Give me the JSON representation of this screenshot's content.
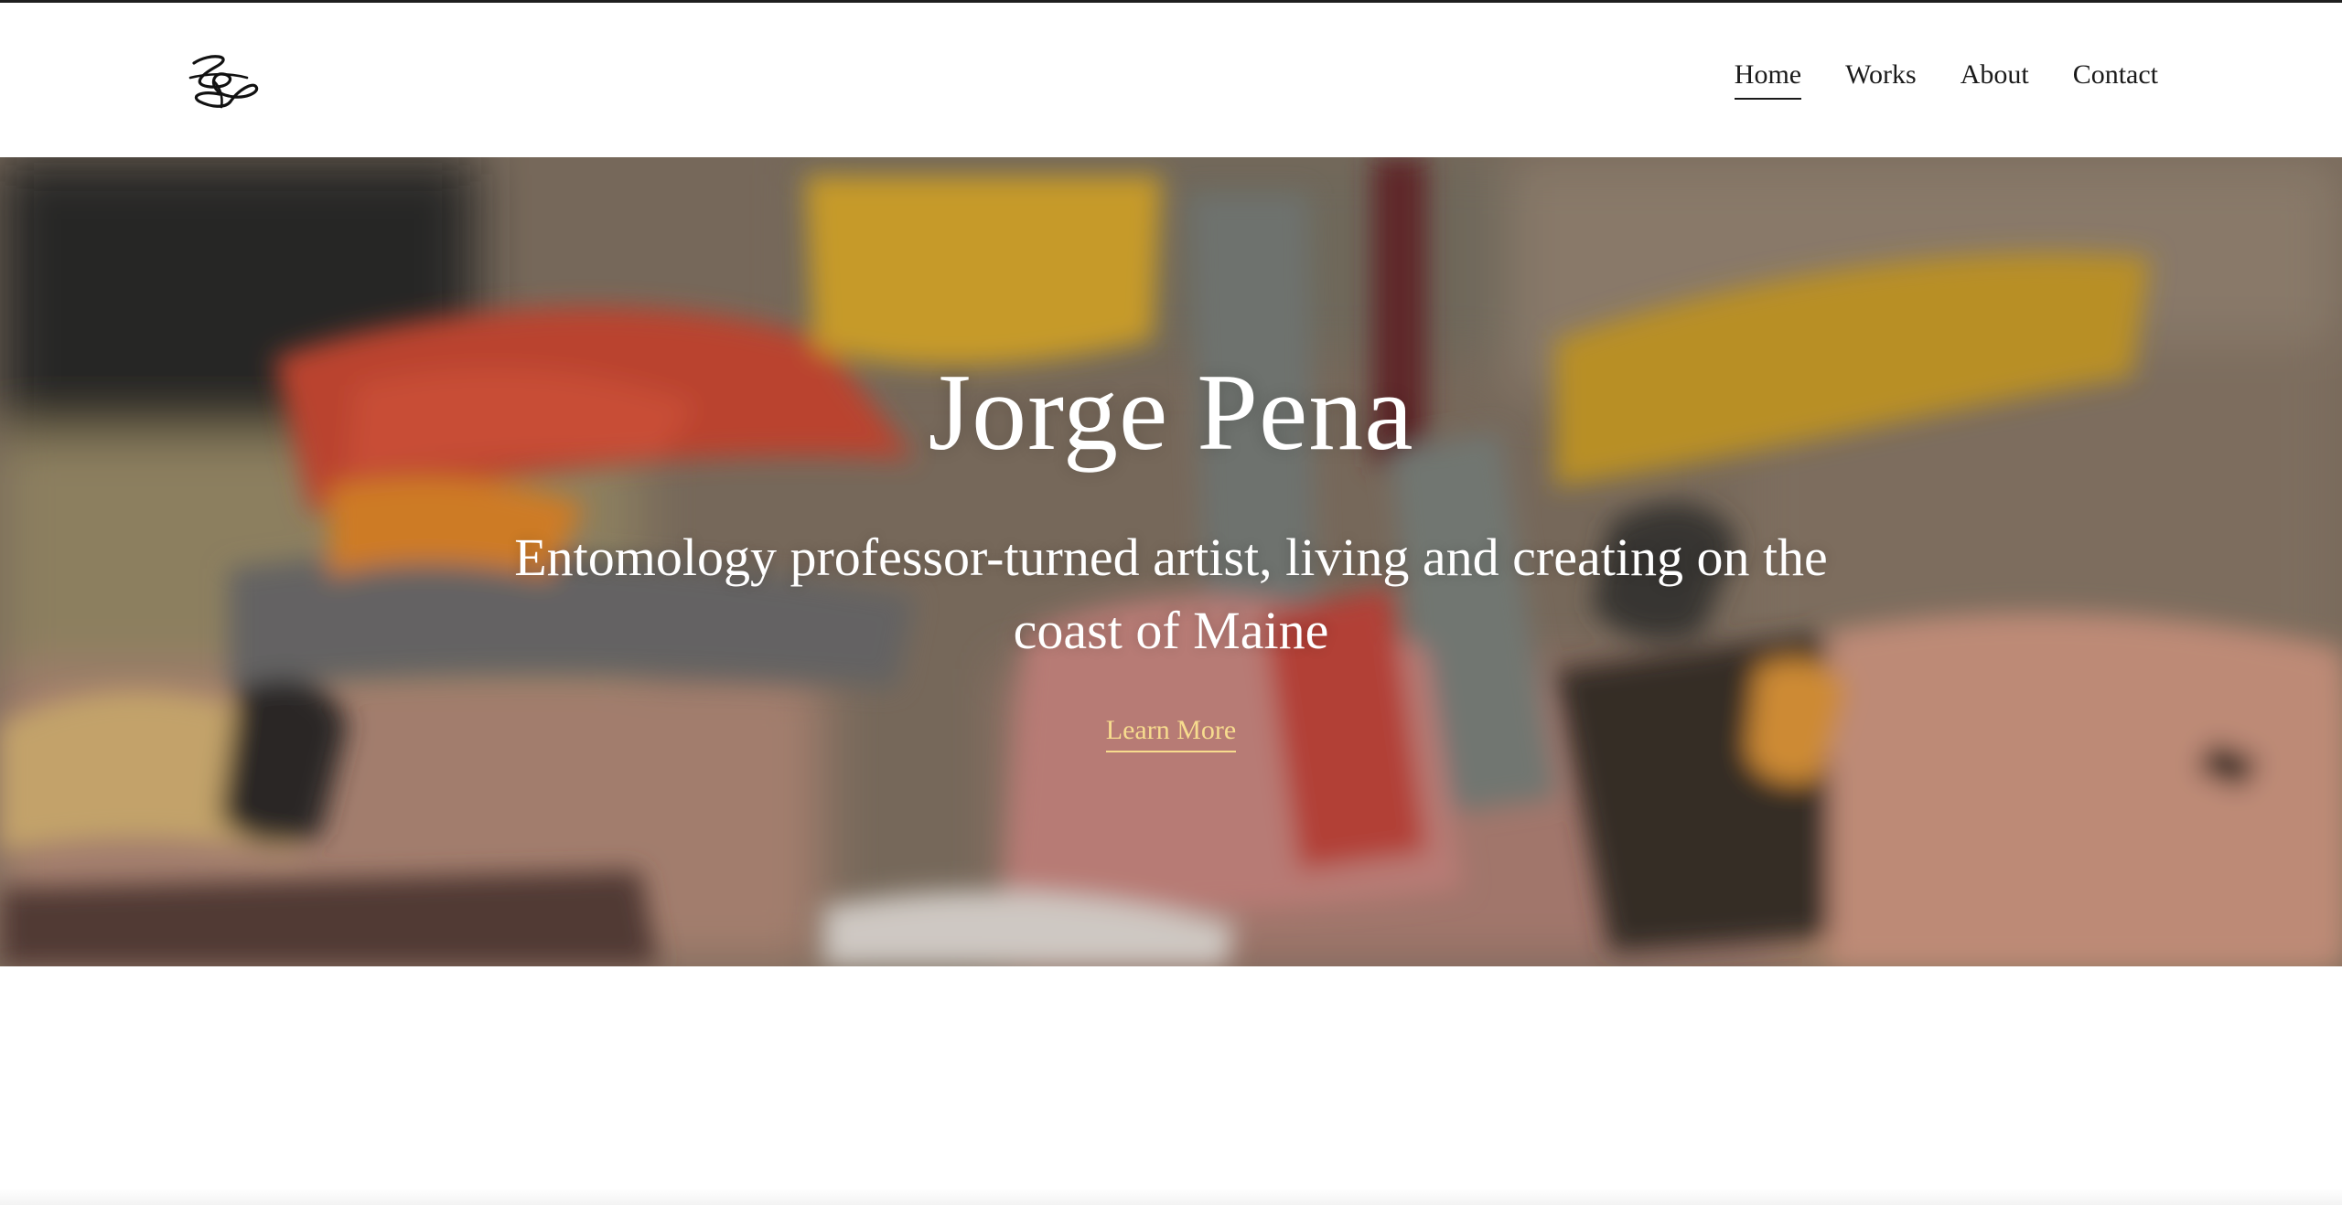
{
  "site": {
    "logo_icon": "signature-logo-icon"
  },
  "nav": {
    "items": [
      {
        "label": "Home",
        "active": true
      },
      {
        "label": "Works",
        "active": false
      },
      {
        "label": "About",
        "active": false
      },
      {
        "label": "Contact",
        "active": false
      }
    ]
  },
  "hero": {
    "title": "Jorge Pena",
    "subtitle": "Entomology professor-turned artist, living and creating on the coast of Maine",
    "cta_label": "Learn More",
    "background": "abstract-painting-image"
  },
  "colors": {
    "cta": "#f7dc8e",
    "text_dark": "#1a1a1a",
    "hero_text": "#ffffff"
  }
}
